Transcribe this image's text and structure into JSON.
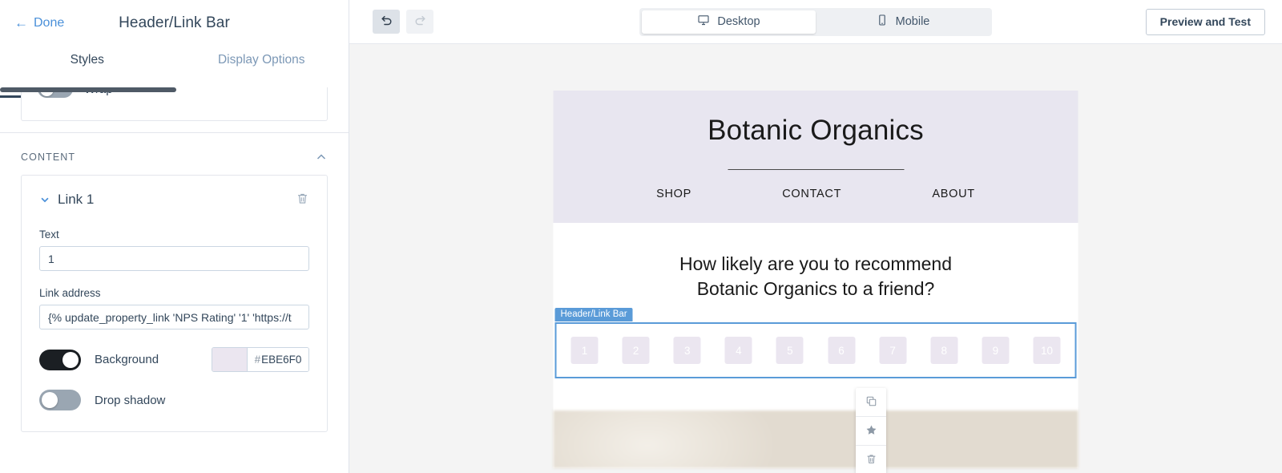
{
  "sidebar": {
    "done_label": "Done",
    "title": "Header/Link Bar",
    "tabs": [
      {
        "label": "Styles",
        "active": true
      },
      {
        "label": "Display Options",
        "active": false
      }
    ],
    "clipped_setting": {
      "label": "Wrap",
      "enabled": false
    },
    "section": {
      "title": "CONTENT",
      "collapse_icon": "chevron-up-icon"
    },
    "link_card": {
      "title": "Link 1",
      "expand_icon": "chevron-down-icon",
      "delete_icon": "trash-icon",
      "text_field": {
        "label": "Text",
        "value": "1"
      },
      "link_field": {
        "label": "Link address",
        "value": "{% update_property_link 'NPS Rating' '1' 'https://t"
      },
      "background": {
        "label": "Background",
        "enabled": true,
        "color": "EBE6F0",
        "hash": "#"
      },
      "drop_shadow": {
        "label": "Drop shadow",
        "enabled": false
      }
    }
  },
  "topbar": {
    "undo_icon": "undo-icon",
    "redo_icon": "redo-icon",
    "devices": [
      {
        "label": "Desktop",
        "icon": "monitor-icon",
        "active": true
      },
      {
        "label": "Mobile",
        "icon": "phone-icon",
        "active": false
      }
    ],
    "preview_label": "Preview and Test"
  },
  "email": {
    "brand": "Botanic Organics",
    "nav": [
      "SHOP",
      "CONTACT",
      "ABOUT"
    ],
    "question_line1": "How likely are you to recommend",
    "question_line2": "Botanic Organics to a friend?",
    "selection_label": "Header/Link Bar",
    "nps_items": [
      "1",
      "2",
      "3",
      "4",
      "5",
      "6",
      "7",
      "8",
      "9",
      "10"
    ],
    "header_bg": "#E8E6F0",
    "nps_item_bg": "#EBE6F0",
    "selection_color": "#5A9BD8"
  },
  "float_tools": [
    {
      "name": "duplicate-icon"
    },
    {
      "name": "star-icon"
    },
    {
      "name": "trash-icon"
    }
  ]
}
